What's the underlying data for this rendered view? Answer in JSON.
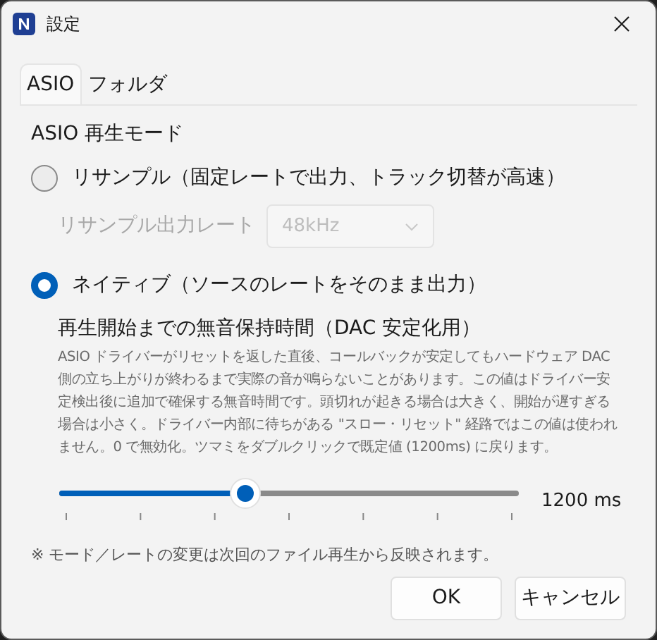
{
  "window": {
    "title": "設定"
  },
  "tabs": [
    {
      "label": "ASIO",
      "selected": true
    },
    {
      "label": "フォルダ",
      "selected": false
    }
  ],
  "section_title": "ASIO 再生モード",
  "modes": [
    {
      "label": "リサンプル（固定レートで出力、トラック切替が高速）",
      "selected": false
    },
    {
      "label": "ネイティブ（ソースのレートをそのまま出力）",
      "selected": true
    }
  ],
  "resample_rate": {
    "label": "リサンプル出力レート",
    "value": "48kHz",
    "disabled": true
  },
  "silence": {
    "title": "再生開始までの無音保持時間（DAC 安定化用）",
    "description": "ASIO ドライバーがリセットを返した直後、コールバックが安定してもハードウェア DAC 側の立ち上がりが終わるまで実際の音が鳴らないことがあります。この値はドライバー安定検出後に追加で確保する無音時間です。頭切れが起きる場合は大きく、開始が遅すぎる場合は小さく。ドライバー内部に待ちがある \"スロー・リセット\" 経路ではこの値は使われません。0 で無効化。ツマミをダブルクリックで既定値 (1200ms) に戻ります。",
    "level": 0.405,
    "reading": "1200 ms"
  },
  "note": "※ モード／レートの変更は次回のファイル再生から反映されます。",
  "buttons": [
    "OK",
    "キャンセル"
  ]
}
